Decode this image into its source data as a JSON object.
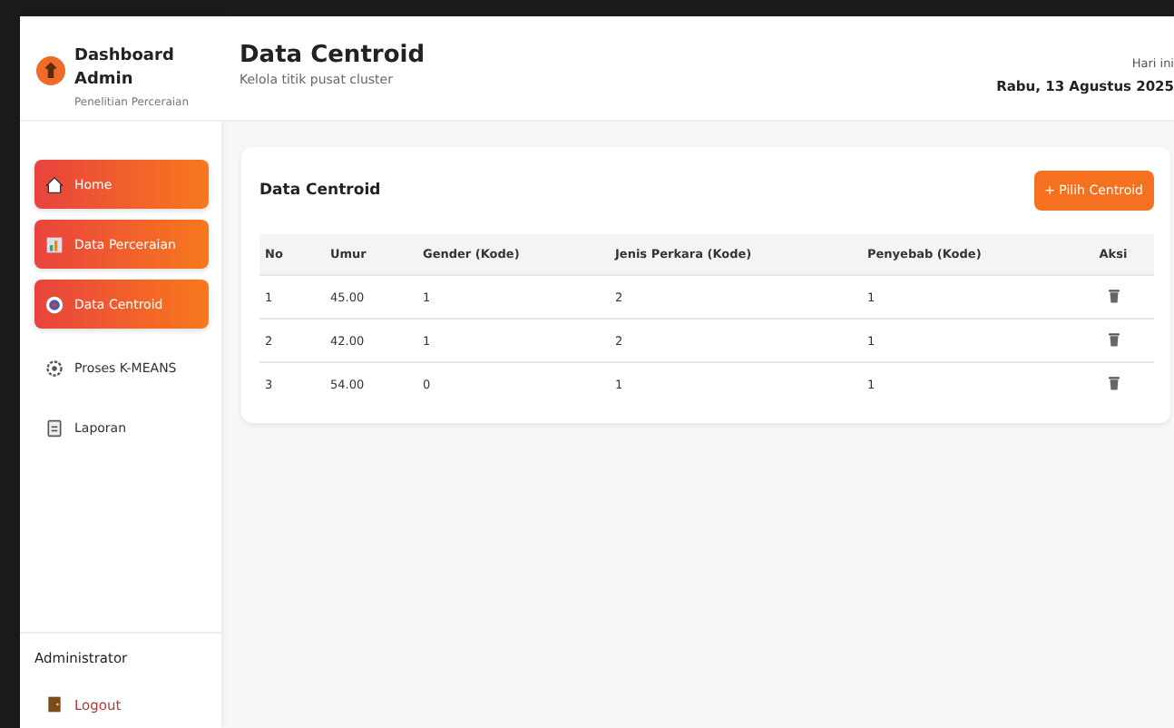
{
  "sidebar": {
    "title": "Dashboard Admin",
    "subtitle": "Penelitian Perceraian",
    "items": [
      {
        "label": "Home",
        "selected": true
      },
      {
        "label": "Data Perceraian",
        "selected": true
      },
      {
        "label": "Data Centroid",
        "selected": true
      },
      {
        "label": "Proses K-MEANS",
        "selected": false
      },
      {
        "label": "Laporan",
        "selected": false
      }
    ],
    "user": "Administrator",
    "logout": "Logout"
  },
  "header": {
    "title": "Data Centroid",
    "subtitle": "Kelola titik pusat cluster",
    "date_label": "Hari ini",
    "date": "Rabu, 13 Agustus 2025"
  },
  "card": {
    "title": "Data Centroid",
    "button": "+ Pilih Centroid",
    "columns": [
      "No",
      "Umur",
      "Gender (Kode)",
      "Jenis Perkara (Kode)",
      "Penyebab (Kode)",
      "Aksi"
    ],
    "rows": [
      [
        "1",
        "45.00",
        "1",
        "2",
        "1"
      ],
      [
        "2",
        "42.00",
        "1",
        "2",
        "1"
      ],
      [
        "3",
        "54.00",
        "0",
        "1",
        "1"
      ]
    ]
  }
}
